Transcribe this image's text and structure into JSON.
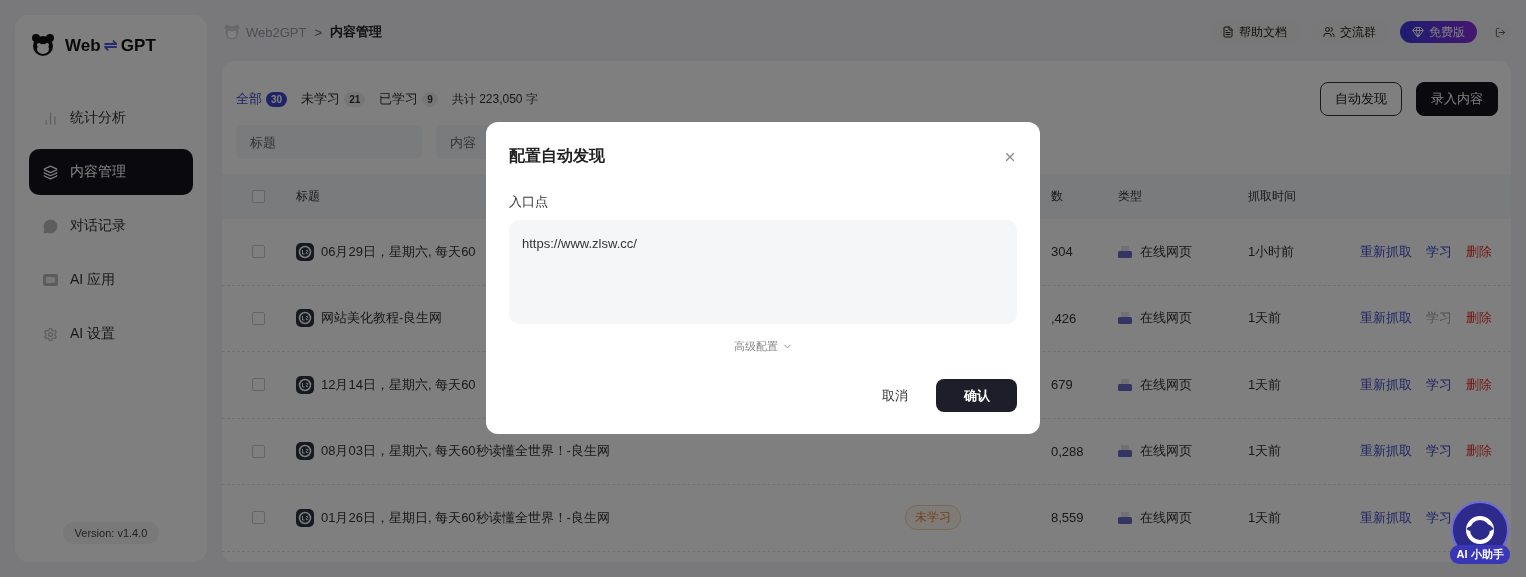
{
  "sidebar": {
    "logo_text": [
      "Web",
      "⇌",
      "GPT"
    ],
    "items": [
      {
        "label": "统计分析",
        "selected": false
      },
      {
        "label": "内容管理",
        "selected": true
      },
      {
        "label": "对话记录",
        "selected": false
      },
      {
        "label": "AI 应用",
        "selected": false
      },
      {
        "label": "AI 设置",
        "selected": false
      }
    ],
    "version": "Version: v1.4.0"
  },
  "breadcrumb": {
    "root": "Web2GPT",
    "separator": ">",
    "current": "内容管理"
  },
  "header_actions": [
    {
      "label": "帮助文档",
      "kind": "doc"
    },
    {
      "label": "交流群",
      "kind": "group"
    },
    {
      "label": "免费版",
      "kind": "plan"
    }
  ],
  "tabs": [
    {
      "label": "全部",
      "count": "30",
      "selected": true
    },
    {
      "label": "未学习",
      "count": "21",
      "selected": false
    },
    {
      "label": "已学习",
      "count": "9",
      "selected": false
    }
  ],
  "total": "共计 223,050 字",
  "buttons": [
    {
      "label": "自动发现",
      "kind": "outline"
    },
    {
      "label": "录入内容",
      "kind": "solid"
    }
  ],
  "filters": [
    {
      "placeholder": "标题"
    },
    {
      "placeholder": "内容"
    }
  ],
  "table": {
    "select_all_checked": false,
    "columns": [
      "标题",
      "数",
      "类型",
      "抓取时间"
    ],
    "rows": [
      {
        "checked": false,
        "title": "06月29日，星期六, 每天60",
        "words": "304",
        "type": "在线网页",
        "time": "1小时前",
        "actions": [
          {
            "label": "重新抓取",
            "kind": "refetch",
            "disabled": false
          },
          {
            "label": "学习",
            "kind": "learn",
            "disabled": false
          },
          {
            "label": "删除",
            "kind": "delete",
            "disabled": false
          }
        ]
      },
      {
        "checked": false,
        "title": "网站美化教程-良生网",
        "words": ",426",
        "type": "在线网页",
        "time": "1天前",
        "actions": [
          {
            "label": "重新抓取",
            "kind": "refetch",
            "disabled": false
          },
          {
            "label": "学习",
            "kind": "learn",
            "disabled": true
          },
          {
            "label": "删除",
            "kind": "delete",
            "disabled": false
          }
        ]
      },
      {
        "checked": false,
        "title": "12月14日，星期六, 每天60",
        "words": "679",
        "type": "在线网页",
        "time": "1天前",
        "actions": [
          {
            "label": "重新抓取",
            "kind": "refetch",
            "disabled": false
          },
          {
            "label": "学习",
            "kind": "learn",
            "disabled": false
          },
          {
            "label": "删除",
            "kind": "delete",
            "disabled": false
          }
        ]
      },
      {
        "checked": false,
        "title": "08月03日，星期六, 每天60秒读懂全世界！-良生网",
        "words": "0,288",
        "type": "在线网页",
        "time": "1天前",
        "actions": [
          {
            "label": "重新抓取",
            "kind": "refetch",
            "disabled": false
          },
          {
            "label": "学习",
            "kind": "learn",
            "disabled": false
          },
          {
            "label": "删除",
            "kind": "delete",
            "disabled": false
          }
        ]
      },
      {
        "checked": false,
        "title": "01月26日，星期日, 每天60秒读懂全世界！-良生网",
        "status": "未学习",
        "words": "8,559",
        "type": "在线网页",
        "time": "1天前",
        "actions": [
          {
            "label": "重新抓取",
            "kind": "refetch",
            "disabled": false
          },
          {
            "label": "学习",
            "kind": "learn",
            "disabled": false
          }
        ]
      }
    ]
  },
  "dialog": {
    "title": "配置自动发现",
    "field_label": "入口点",
    "field_value": "https://www.zlsw.cc/",
    "advanced": "高级配置",
    "cancel": "取消",
    "confirm": "确认"
  },
  "assistant": {
    "label": "AI 小助手"
  }
}
